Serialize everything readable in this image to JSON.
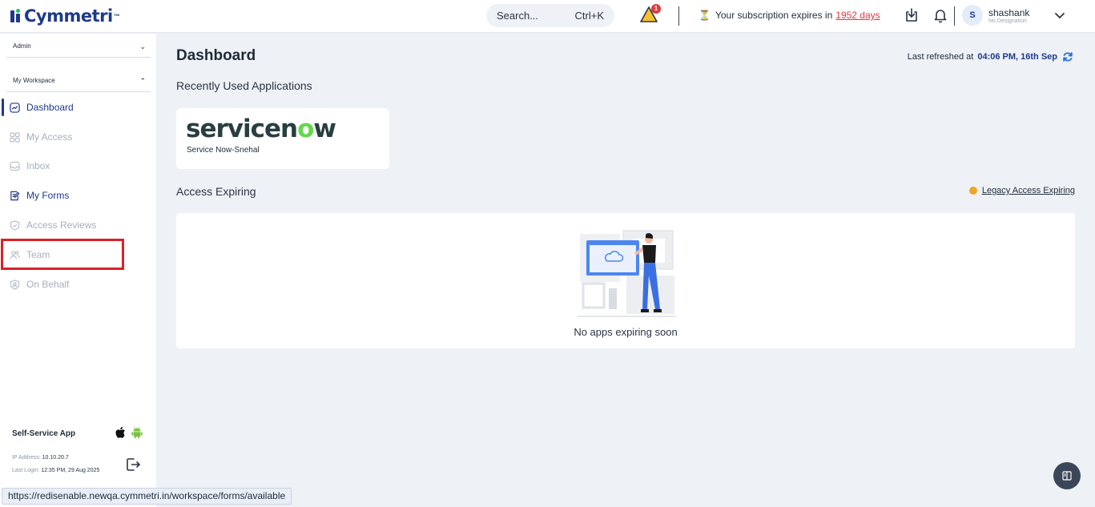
{
  "header": {
    "logo_text": "Cymmetri",
    "logo_tm": "™",
    "search_placeholder": "Search...",
    "search_shortcut": "Ctrl+K",
    "alert_count": "1",
    "subscription_text": "Your subscription expires in",
    "subscription_days": "1952 days",
    "user": {
      "initial": "S",
      "name": "shashank",
      "designation": "No Designation"
    }
  },
  "sidebar": {
    "sections": {
      "admin": "Admin",
      "workspace": "My Workspace"
    },
    "items": [
      {
        "label": "Dashboard",
        "icon": "dashboard-icon",
        "state": "active"
      },
      {
        "label": "My Access",
        "icon": "grid-icon",
        "state": "disabled"
      },
      {
        "label": "Inbox",
        "icon": "inbox-icon",
        "state": "disabled"
      },
      {
        "label": "My Forms",
        "icon": "form-icon",
        "state": "normal"
      },
      {
        "label": "Access Reviews",
        "icon": "shield-check-icon",
        "state": "disabled"
      },
      {
        "label": "Team",
        "icon": "team-icon",
        "state": "disabled"
      },
      {
        "label": "On Behalf",
        "icon": "badge-user-icon",
        "state": "disabled"
      }
    ],
    "self_service_label": "Self-Service App",
    "ip_label": "IP Address:",
    "ip_value": "10.10.20.7",
    "last_login_label": "Last Login:",
    "last_login_value": "12:35 PM, 29 Aug 2025"
  },
  "main": {
    "title": "Dashboard",
    "last_refreshed_label": "Last refreshed at",
    "last_refreshed_value": "04:06 PM, 16th Sep",
    "recent_apps_title": "Recently Used Applications",
    "recent_apps": [
      {
        "logo_main": "servicen",
        "logo_o": "o",
        "logo_end": "w",
        "caption": "Service Now-Snehal"
      }
    ],
    "access_expiring_title": "Access Expiring",
    "legacy_link": "Legacy Access Expiring",
    "empty_message": "No apps expiring soon"
  },
  "statusbar": {
    "url": "https://redisenable.newqa.cymmetri.in/workspace/forms/available"
  },
  "colors": {
    "brand": "#1e3a8a",
    "alert": "#e0383e",
    "warning": "#f0a522",
    "highlight": "#d92027"
  }
}
